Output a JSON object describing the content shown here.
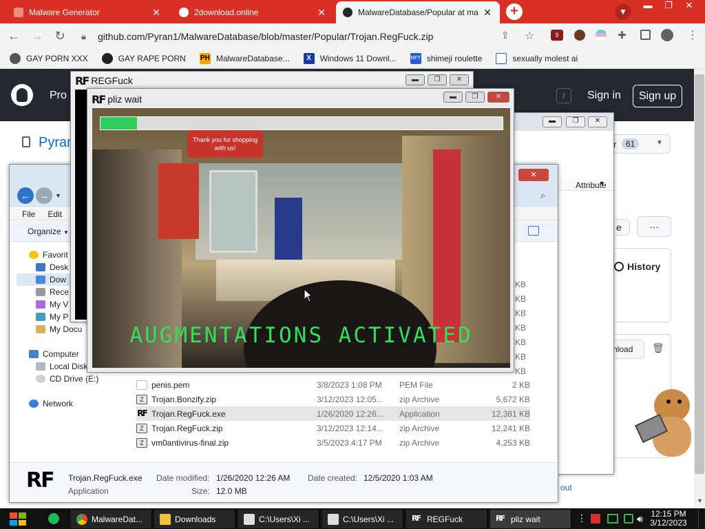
{
  "browser": {
    "tabs": [
      {
        "title": "Malware Generator",
        "active": false
      },
      {
        "title": "2download.online",
        "active": false
      },
      {
        "title": "MalwareDatabase/Popular at ma",
        "active": true
      }
    ],
    "url": "github.com/Pyran1/MalwareDatabase/blob/master/Popular/Trojan.RegFuck.zip",
    "extension_badge": "9",
    "bookmarks": [
      "GAY PORN XXX",
      "GAY RAPE PORN",
      "MalwareDatabase...",
      "Windows 11 Downl...",
      "shimeji roulette",
      "sexually molest ai"
    ],
    "bookmark_icon_labels": [
      "PH",
      "X",
      "MFT"
    ]
  },
  "github": {
    "nav_partial": "Pro",
    "slash_key": "/",
    "sign_in": "Sign in",
    "sign_up": "Sign up",
    "repo_partial": "Pyran",
    "star_partial": "r",
    "star_count": "61",
    "attribute_header": "Attribute",
    "e_partial": "e",
    "more": "···",
    "history": "History",
    "download_partial": "nload",
    "link_partial": "out"
  },
  "explorer": {
    "menu": [
      "File",
      "Edit"
    ],
    "organize": "Organize",
    "nav_items": [
      "Favorit",
      "Desk",
      "Dow",
      "Rece",
      "My V",
      "My P",
      "My Docu",
      "Computer",
      "Local Disk",
      "CD Drive (E:)",
      "Network"
    ],
    "size_suffix": "KB",
    "files": [
      {
        "name": "penis.pem",
        "date": "3/8/2023 1:08 PM",
        "type": "PEM File",
        "size": "2 KB"
      },
      {
        "name": "Trojan.Bonzify.zip",
        "date": "3/12/2023 12:05...",
        "type": "zip Archive",
        "size": "5,672 KB"
      },
      {
        "name": "Trojan.RegFuck.exe",
        "date": "1/26/2020 12:26...",
        "type": "Application",
        "size": "12,381 KB",
        "selected": true
      },
      {
        "name": "Trojan.RegFuck.zip",
        "date": "3/12/2023 12:14...",
        "type": "zip Archive",
        "size": "12,241 KB"
      },
      {
        "name": "vm0antivirus-final.zip",
        "date": "3/5/2023 4:17 PM",
        "type": "zip Archive",
        "size": "4,253 KB"
      }
    ],
    "details": {
      "name": "Trojan.RegFuck.exe",
      "modified_label": "Date modified:",
      "modified": "1/26/2020 12:26 AM",
      "created_label": "Date created:",
      "created": "12/5/2020 1:03 AM",
      "type": "Application",
      "size_label": "Size:",
      "size": "12.0 MB"
    }
  },
  "regfuck_window": {
    "logo": "RF",
    "title": "REGFuck"
  },
  "pliz_window": {
    "logo": "RF",
    "title": "pliz wait",
    "progress": 0.09,
    "store_sign": "Thank you for shopping with us!",
    "caption": "AUGMENTATIONS ACTIVATED"
  },
  "taskbar": {
    "items": [
      "MalwareDat...",
      "Downloads",
      "C:\\Users\\Xi ...",
      "C:\\Users\\Xi ...",
      "REGFuck",
      "pliz wait"
    ],
    "time": "12:15 PM",
    "date": "3/12/2023"
  },
  "colors": {
    "chrome_red": "#d93025",
    "github_dark": "#24292f",
    "progress_green": "#2ecc5a",
    "caption_green": "#33e05a"
  }
}
